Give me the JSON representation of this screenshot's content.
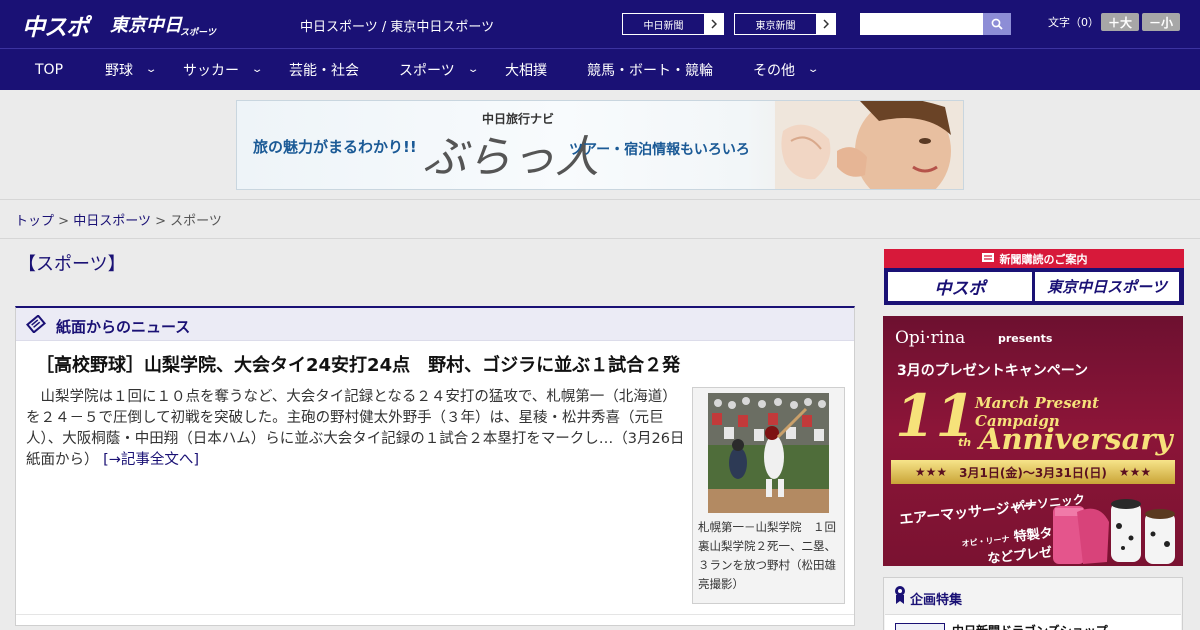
{
  "header": {
    "logo_chuspo": "中スポ",
    "logo_tokyo": "東京中日",
    "logo_tokyo_sub": "スポーツ",
    "site_title": "中日スポーツ / 東京中日スポーツ",
    "newspaper_links": [
      "中日新聞",
      "東京新聞"
    ],
    "search": {
      "placeholder": "",
      "value": ""
    },
    "font_size_label": "文字（0）",
    "font_up_label": "＋大",
    "font_down_label": "－小"
  },
  "nav": {
    "items": [
      {
        "label": "TOP",
        "has_dropdown": false
      },
      {
        "label": "野球",
        "has_dropdown": true
      },
      {
        "label": "サッカー",
        "has_dropdown": true
      },
      {
        "label": "芸能・社会",
        "has_dropdown": false
      },
      {
        "label": "スポーツ",
        "has_dropdown": true
      },
      {
        "label": "大相撲",
        "has_dropdown": false
      },
      {
        "label": "競馬・ボート・競輪",
        "has_dropdown": false
      },
      {
        "label": "その他",
        "has_dropdown": true
      }
    ]
  },
  "banner": {
    "left_text": "旅の魅力がまるわかり!!",
    "navi_label": "中日旅行ナビ",
    "brand": "ぶらっ人",
    "right_text": "ツアー・宿泊情報もいろいろ"
  },
  "breadcrumb": {
    "items": [
      "トップ",
      "中日スポーツ",
      "スポーツ"
    ],
    "separator": ">"
  },
  "page": {
    "title": "【スポーツ】"
  },
  "news": {
    "section_label": "紙面からのニュース",
    "headline": "［高校野球］山梨学院、大会タイ24安打24点　野村、ゴジラに並ぶ１試合２発",
    "body": "　山梨学院は１回に１０点を奪うなど、大会タイ記録となる２４安打の猛攻で、札幌第一（北海道）を２４－５で圧倒して初戦を突破した。主砲の野村健太外野手（３年）は、星稜・松井秀喜（元巨人）、大阪桐蔭・中田翔（日本ハム）らに並ぶ大会タイ記録の１試合２本塁打をマークし…（3月26日 紙面から）",
    "more_link": "[→記事全文へ]",
    "photo_caption": "札幌第一－山梨学院　１回裏山梨学院２死一、二塁、３ランを放つ野村（松田雄亮撮影）"
  },
  "sidebar": {
    "subscription": {
      "header": "新聞購読のご案内",
      "tiles": [
        "中スポ",
        "東京中日スポーツ"
      ]
    },
    "campaign": {
      "brand": "Opi·rina",
      "presents": "presents",
      "title": "3月のプレゼントキャンペーン",
      "number": "11",
      "number_suffix": "th",
      "subtitle": "March Present Campaign",
      "anniversary": "Anniversary",
      "dates": "3月1日(金)～3月31日(日)",
      "brand2": "パナソニック",
      "item": "エアーマッサージャー",
      "item2": "特製タンブラー",
      "item2_brand": "オピ・リーナ",
      "gift_suffix": "などプレゼント!"
    },
    "feature": {
      "label": "企画特集",
      "link": "中日新聞ドラゴンズショップ"
    }
  },
  "colors": {
    "header_bg": "#1a1175",
    "accent_red": "#d7193a",
    "campaign_bg": "#8c1538",
    "gold": "#f6e27a"
  },
  "icons": {
    "search": "search-icon",
    "chevron": "chevron-right-icon",
    "dropdown": "chevron-down-icon",
    "news_section": "newspaper-icon",
    "feature": "ribbon-icon"
  }
}
